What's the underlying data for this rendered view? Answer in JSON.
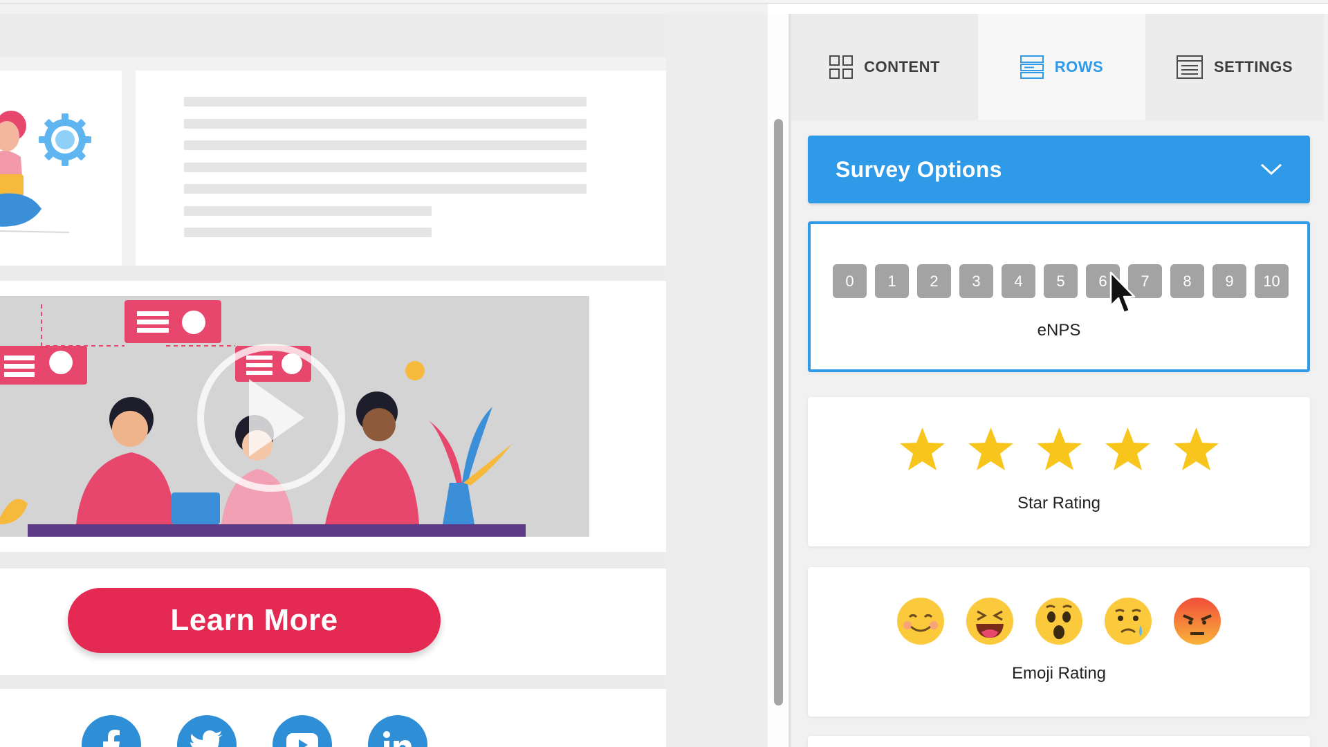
{
  "sidebar": {
    "tabs": [
      {
        "label": "CONTENT",
        "icon": "grid-icon",
        "active": false
      },
      {
        "label": "ROWS",
        "icon": "rows-icon",
        "active": true
      },
      {
        "label": "SETTINGS",
        "icon": "settings-list-icon",
        "active": false
      }
    ],
    "survey_options": {
      "title": "Survey Options",
      "icon": "chevron-down-icon"
    },
    "cards": {
      "enps": {
        "label": "eNPS",
        "scale": [
          "0",
          "1",
          "2",
          "3",
          "4",
          "5",
          "6",
          "7",
          "8",
          "9",
          "10"
        ]
      },
      "star": {
        "label": "Star Rating",
        "stars": 5
      },
      "emoji": {
        "label": "Emoji Rating",
        "emojis": [
          "smiling-emoji",
          "laughing-emoji",
          "surprised-emoji",
          "sad-emoji",
          "angry-emoji"
        ]
      }
    }
  },
  "canvas": {
    "button_label": "Learn More",
    "social": [
      "facebook-icon",
      "twitter-icon",
      "youtube-icon",
      "linkedin-icon"
    ]
  },
  "colors": {
    "accent": "#2f9ae8",
    "button": "#e42a52",
    "star": "#f8c51c",
    "nps_box": "#a3a3a3",
    "social": "#2f8fd6"
  }
}
